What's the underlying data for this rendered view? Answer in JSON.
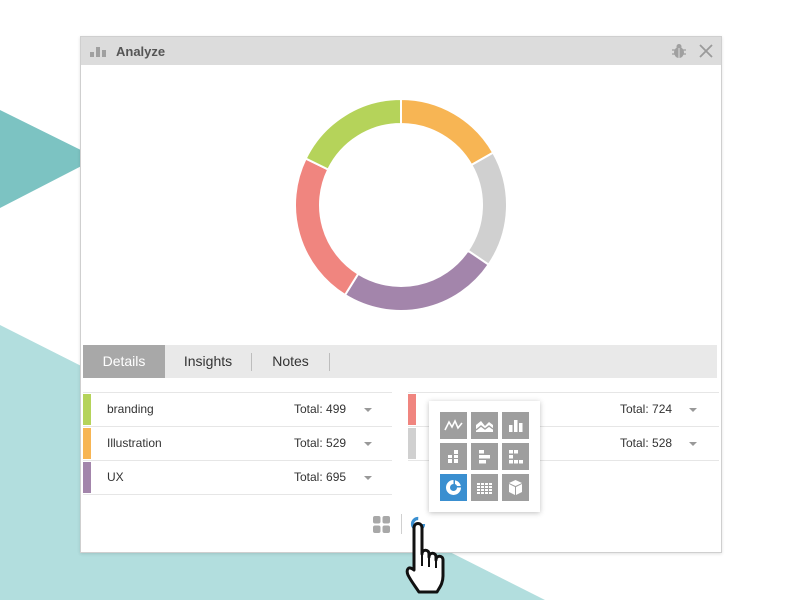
{
  "window": {
    "title": "Analyze"
  },
  "tabs": [
    {
      "label": "Details",
      "active": true
    },
    {
      "label": "Insights",
      "active": false
    },
    {
      "label": "Notes",
      "active": false
    }
  ],
  "left_list": [
    {
      "label": "branding",
      "total": "Total: 499",
      "color": "#b5d35a"
    },
    {
      "label": "Illustration",
      "total": "Total: 529",
      "color": "#f7b554"
    },
    {
      "label": "UX",
      "total": "Total: 695",
      "color": "#a385ab"
    }
  ],
  "right_list": [
    {
      "label": "",
      "total": "Total: 724",
      "color": "#f0857f"
    },
    {
      "label": "",
      "total": "Total: 528",
      "color": "#d0d0d0"
    }
  ],
  "chart_types": [
    "line-chart-icon",
    "area-chart-icon",
    "bar-chart-icon",
    "stacked-bar-icon",
    "horizontal-bar-icon",
    "horizontal-stacked-icon",
    "donut-chart-icon",
    "table-chart-icon",
    "box-3d-icon"
  ],
  "selected_chart_type": "donut-chart-icon",
  "chart_data": {
    "type": "pie",
    "donut": true,
    "slices": [
      {
        "value": 499,
        "color": "#f7b554"
      },
      {
        "value": 528,
        "color": "#d0d0d0"
      },
      {
        "value": 724,
        "color": "#a385ab"
      },
      {
        "value": 695,
        "color": "#f0857f"
      },
      {
        "value": 529,
        "color": "#b5d35a"
      }
    ]
  },
  "colors": {
    "accent": "#3a8fd0",
    "teal": "#7cc3c2",
    "teal_light": "#b2dede"
  }
}
